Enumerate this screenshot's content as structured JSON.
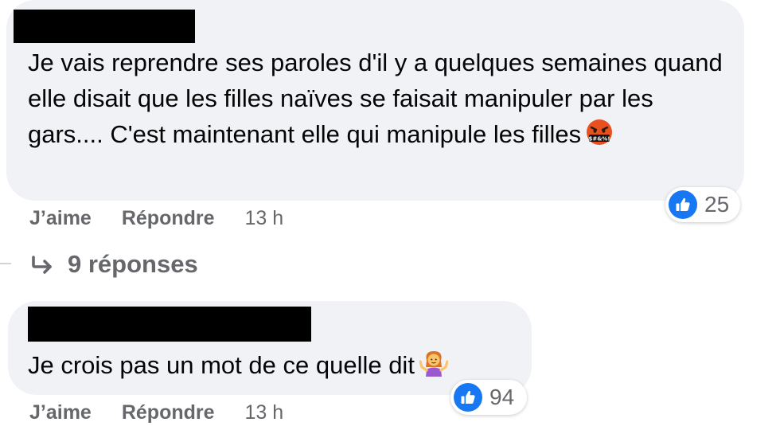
{
  "comments": [
    {
      "author_redacted": true,
      "text": "Je vais reprendre ses paroles d'il y a quelques semaines quand elle disait que les filles naïves se faisait manipuler par les gars.... C'est maintenant elle qui manipule les filles",
      "emoji": "face-with-symbols-on-mouth",
      "reactions": {
        "icon": "like-icon",
        "count": "25"
      },
      "actions": {
        "like": "J’aime",
        "reply": "Répondre",
        "time": "13 h"
      }
    },
    {
      "author_redacted": true,
      "text": "Je crois pas un mot de ce quelle dit",
      "emoji": "person-shrugging",
      "reactions": {
        "icon": "like-icon",
        "count": "94"
      },
      "actions": {
        "like": "J’aime",
        "reply": "Répondre",
        "time": "13 h"
      }
    }
  ],
  "replies_link": {
    "icon": "reply-arrow-icon",
    "label": "9 réponses"
  },
  "colors": {
    "bubble": "#f0f2f5",
    "text": "#050505",
    "secondary": "#65676b",
    "like_blue": "#1877f2",
    "redaction": "#000000"
  }
}
